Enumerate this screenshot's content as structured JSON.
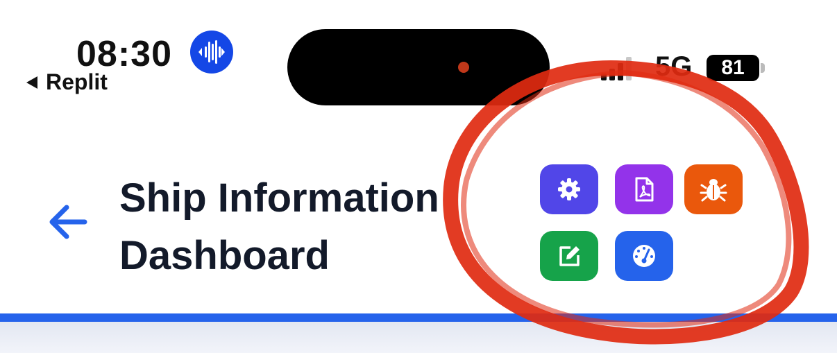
{
  "status_bar": {
    "time": "08:30",
    "back_app": "Replit",
    "network": "5G",
    "battery": "81",
    "siri_icon": "waveform-icon",
    "accent_blue": "#1447e6"
  },
  "header": {
    "back_icon": "arrow-left-icon",
    "title": "Ship Information Dashboard",
    "buttons": [
      {
        "name": "settings-button",
        "icon": "gear-icon",
        "color": "#5146e8"
      },
      {
        "name": "pdf-button",
        "icon": "pdf-file-icon",
        "color": "#9333ea"
      },
      {
        "name": "debug-button",
        "icon": "bug-icon",
        "color": "#ea580c"
      },
      {
        "name": "edit-button",
        "icon": "edit-icon",
        "color": "#16a34a"
      },
      {
        "name": "dashboard-button",
        "icon": "gauge-icon",
        "color": "#2563eb"
      }
    ],
    "accent_line_color": "#2563eb"
  },
  "annotation": {
    "shape": "hand-drawn circle",
    "color": "#e02a10"
  }
}
